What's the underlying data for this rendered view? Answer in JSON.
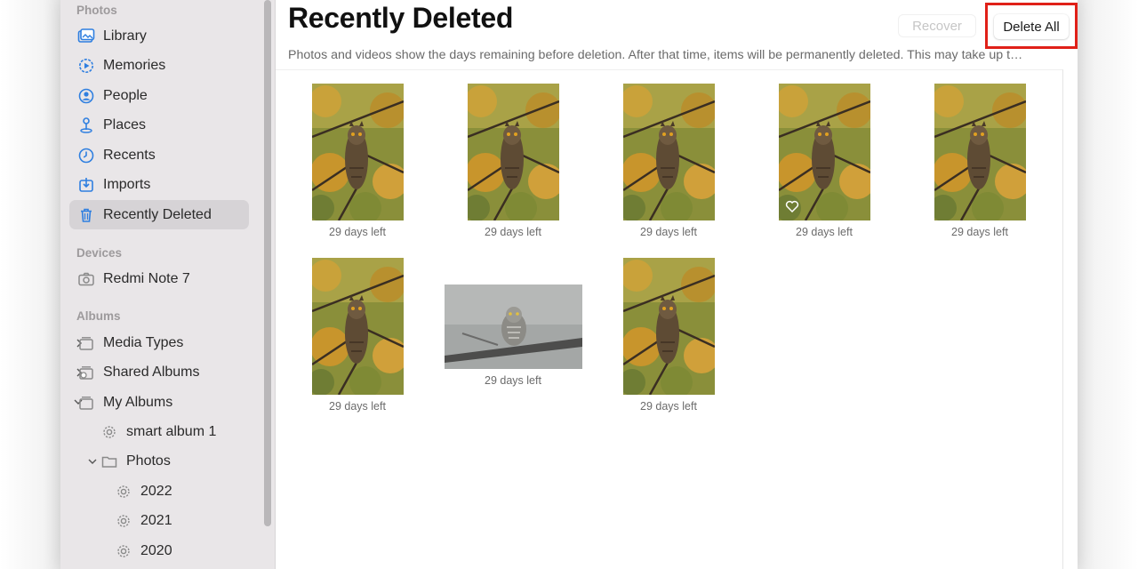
{
  "sidebar": {
    "sections": {
      "photos": "Photos",
      "devices": "Devices",
      "albums": "Albums"
    },
    "items": [
      {
        "label": "Library",
        "icon": "library-icon"
      },
      {
        "label": "Memories",
        "icon": "memories-icon"
      },
      {
        "label": "People",
        "icon": "people-icon"
      },
      {
        "label": "Places",
        "icon": "places-icon"
      },
      {
        "label": "Recents",
        "icon": "recents-icon"
      },
      {
        "label": "Imports",
        "icon": "imports-icon"
      },
      {
        "label": "Recently Deleted",
        "icon": "trash-icon",
        "selected": true
      }
    ],
    "devices": [
      {
        "label": "Redmi Note 7",
        "icon": "camera-icon"
      }
    ],
    "albums": [
      {
        "label": "Media Types",
        "icon": "stack-icon",
        "chevron": "right"
      },
      {
        "label": "Shared Albums",
        "icon": "shared-stack-icon",
        "chevron": "right"
      },
      {
        "label": "My Albums",
        "icon": "stack-icon",
        "chevron": "down"
      },
      {
        "label": "smart album 1",
        "icon": "gear-icon"
      },
      {
        "label": "Photos",
        "icon": "folder-icon",
        "chevron": "down"
      },
      {
        "label": "2022",
        "icon": "gear-icon"
      },
      {
        "label": "2021",
        "icon": "gear-icon"
      },
      {
        "label": "2020",
        "icon": "gear-icon"
      }
    ]
  },
  "main": {
    "title": "Recently Deleted",
    "subtitle": "Photos and videos show the days remaining before deletion. After that time, items will be permanently deleted. This may take up t…",
    "recover_label": "Recover",
    "delete_all_label": "Delete All",
    "highlight_color": "#e02018",
    "photos": [
      {
        "caption": "29 days left",
        "kind": "owl-portrait"
      },
      {
        "caption": "29 days left",
        "kind": "owl-portrait"
      },
      {
        "caption": "29 days left",
        "kind": "owl-portrait"
      },
      {
        "caption": "29 days left",
        "kind": "owl-portrait",
        "favorite": true
      },
      {
        "caption": "29 days left",
        "kind": "owl-portrait"
      },
      {
        "caption": "29 days left",
        "kind": "owl-portrait"
      },
      {
        "caption": "29 days left",
        "kind": "owl-landscape-gray"
      },
      {
        "caption": "29 days left",
        "kind": "owl-portrait"
      }
    ]
  }
}
